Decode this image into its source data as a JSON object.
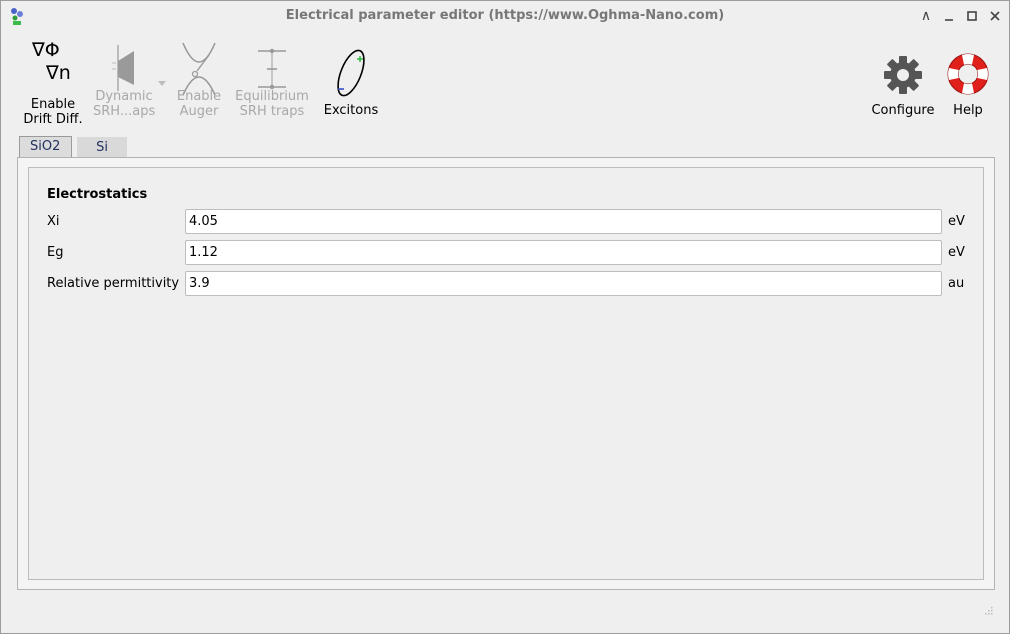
{
  "window": {
    "title": "Electrical parameter editor (https://www.Oghma-Nano.com)",
    "controls": {
      "minimize_glyph": "—",
      "restore_glyph": "□",
      "close_glyph": "✕",
      "shade_glyph": "∧"
    }
  },
  "toolbar": {
    "drift_diff": {
      "icon_text_top": "∇Φ",
      "icon_text_bottom": "∇n",
      "label_line1": "Enable",
      "label_line2": "Drift Diff.",
      "enabled": true
    },
    "dynamic_srh": {
      "label_line1": "Dynamic",
      "label_line2": "SRH...aps",
      "enabled": false,
      "has_dropdown": true
    },
    "auger": {
      "label_line1": "Enable",
      "label_line2": "Auger",
      "enabled": false
    },
    "equilibrium_srh": {
      "label_line1": "Equilibrium",
      "label_line2": "SRH traps",
      "enabled": false
    },
    "excitons": {
      "label": "Excitons",
      "enabled": true
    },
    "configure": {
      "label": "Configure"
    },
    "help": {
      "label": "Help"
    }
  },
  "tabs": [
    {
      "label": "SiO2",
      "active": true
    },
    {
      "label": "Si",
      "active": false
    }
  ],
  "section": {
    "title": "Electrostatics",
    "rows": [
      {
        "label": "Xi",
        "value": "4.05",
        "unit": "eV"
      },
      {
        "label": "Eg",
        "value": "1.12",
        "unit": "eV"
      },
      {
        "label": "Relative permittivity",
        "value": "3.9",
        "unit": "au"
      }
    ]
  },
  "colors": {
    "accent": "#3c4fa1",
    "disabled_text": "#a8a8a8",
    "help_red": "#e0201b",
    "gear": "#555555"
  }
}
